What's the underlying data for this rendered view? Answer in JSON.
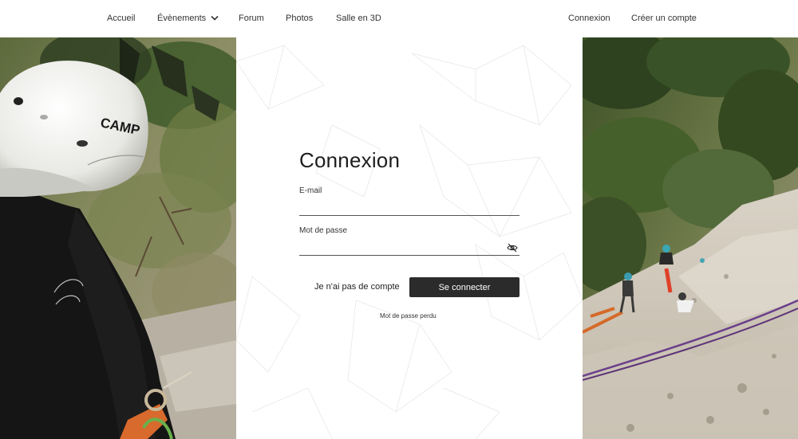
{
  "nav": {
    "home": "Accueil",
    "events": "Évènements",
    "forum": "Forum",
    "photos": "Photos",
    "room3d": "Salle en 3D",
    "login": "Connexion",
    "register": "Créer un compte"
  },
  "login": {
    "title": "Connexion",
    "email_label": "E-mail",
    "email_value": "",
    "password_label": "Mot de passe",
    "password_value": "",
    "no_account": "Je n'ai pas de compte",
    "submit": "Se connecter",
    "forgot": "Mot de passe perdu"
  },
  "images": {
    "left": "climber with white CAMP helmet",
    "right": "climbers on a rock face",
    "helmet_logo": "CAMP"
  },
  "colors": {
    "button_bg": "#2b2b2b",
    "button_text": "#ffffff",
    "text": "#333333",
    "input_border": "#555555"
  },
  "icons": {
    "events_dropdown": "chevron-down-icon",
    "password_toggle": "eye-off-icon"
  }
}
